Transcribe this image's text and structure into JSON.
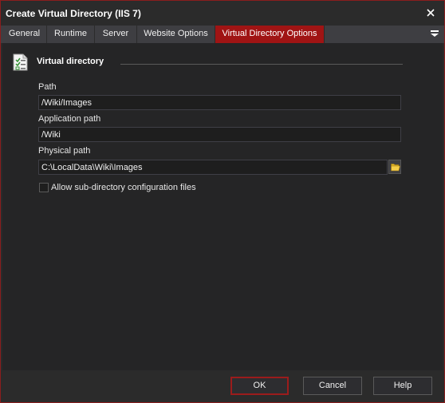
{
  "window": {
    "title": "Create Virtual Directory (IIS 7)"
  },
  "tabs": [
    {
      "label": "General"
    },
    {
      "label": "Runtime"
    },
    {
      "label": "Server"
    },
    {
      "label": "Website Options"
    },
    {
      "label": "Virtual Directory Options"
    }
  ],
  "active_tab": "Virtual Directory Options",
  "section": {
    "title": "Virtual directory",
    "icon": "checklist-icon"
  },
  "fields": {
    "path": {
      "label": "Path",
      "value": "/Wiki/Images"
    },
    "application_path": {
      "label": "Application path",
      "value": "/Wiki"
    },
    "physical_path": {
      "label": "Physical path",
      "value": "C:\\LocalData\\Wiki\\Images",
      "browse_icon": "folder-open-icon"
    }
  },
  "options": {
    "allow_subdir_config": {
      "label": "Allow sub-directory configuration files",
      "checked": false
    }
  },
  "buttons": {
    "ok": "OK",
    "cancel": "Cancel",
    "help": "Help"
  },
  "colors": {
    "accent": "#a01414",
    "background": "#2b2b2b",
    "panel": "#252526"
  }
}
